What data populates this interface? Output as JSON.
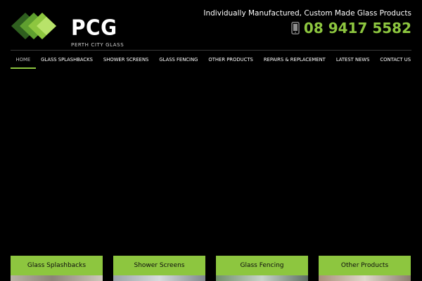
{
  "brand": {
    "name": "PCG",
    "subtitle": "PERTH CITY GLASS",
    "accent_color": "#8dc63f",
    "logo_icon": "stacked-glass-panes-logo"
  },
  "header": {
    "tagline": "Individually Manufactured, Custom Made Glass Products",
    "phone_icon": "mobile-phone-icon",
    "phone": "08 9417 5582"
  },
  "nav": {
    "items": [
      {
        "label": "Home",
        "active": true
      },
      {
        "label": "Glass Splashbacks",
        "active": false
      },
      {
        "label": "Shower Screens",
        "active": false
      },
      {
        "label": "Glass Fencing",
        "active": false
      },
      {
        "label": "Other Products",
        "active": false
      },
      {
        "label": "Repairs & Replacement",
        "active": false
      },
      {
        "label": "Latest News",
        "active": false
      },
      {
        "label": "Contact Us",
        "active": false
      }
    ]
  },
  "cards": [
    {
      "label": "Glass Splashbacks"
    },
    {
      "label": "Shower Screens"
    },
    {
      "label": "Glass Fencing"
    },
    {
      "label": "Other Products"
    }
  ]
}
